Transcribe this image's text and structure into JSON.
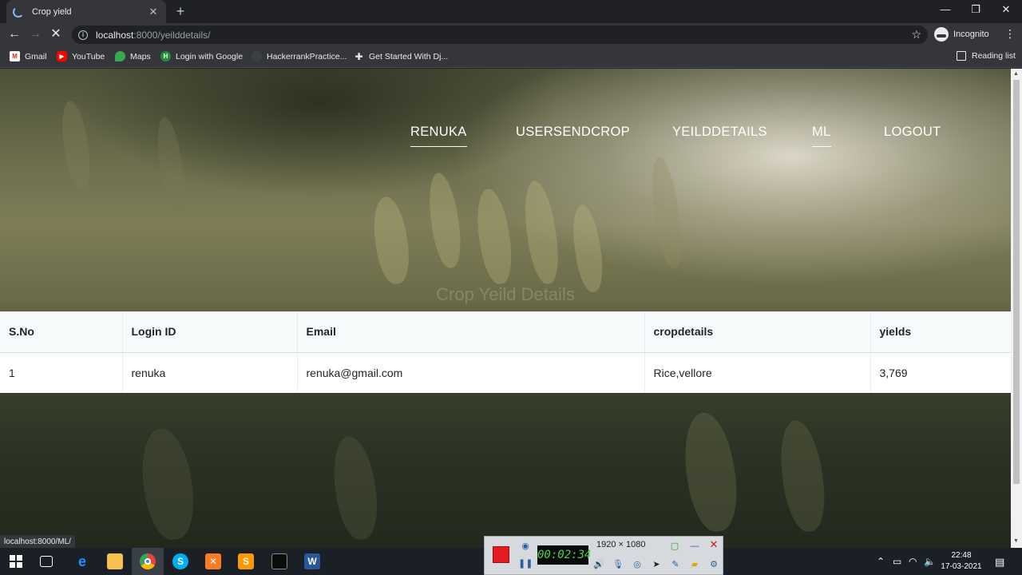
{
  "browser": {
    "tab_title": "Crop yield",
    "new_tab_symbol": "+",
    "url_host": "localhost",
    "url_path": ":8000/yeilddetails/",
    "profile_label": "Incognito",
    "bookmarks": [
      "Gmail",
      "YouTube",
      "Maps",
      "Login with Google",
      "HackerrankPractice...",
      "Get Started With Dj..."
    ],
    "reading_list": "Reading list",
    "status_url": "localhost:8000/ML/"
  },
  "nav": {
    "items": [
      "RENUKA",
      "USERSENDCROP",
      "YEILDDETAILS",
      "ML",
      "LOGOUT"
    ]
  },
  "page": {
    "heading": "Crop Yeild Details"
  },
  "table": {
    "headers": [
      "S.No",
      "Login ID",
      "Email",
      "cropdetails",
      "yields"
    ],
    "rows": [
      [
        "1",
        "renuka",
        "renuka@gmail.com",
        "Rice,vellore",
        "3,769"
      ]
    ]
  },
  "recorder": {
    "timer": "00:02:34",
    "resolution": "1920 × 1080"
  },
  "taskbar": {
    "time": "22:48",
    "date": "17-03-2021"
  }
}
